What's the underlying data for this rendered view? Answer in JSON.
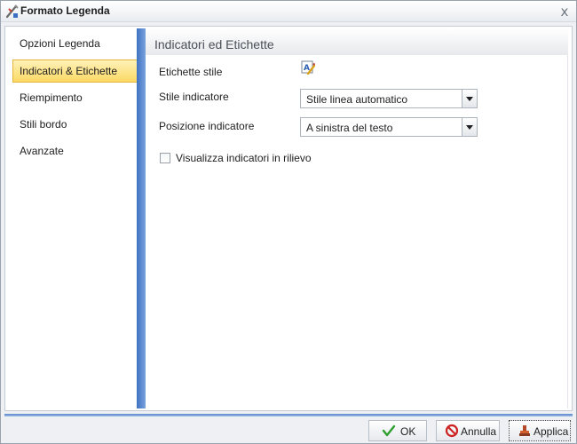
{
  "window": {
    "title": "Formato Legenda",
    "close_symbol": "x"
  },
  "sidebar": {
    "items": [
      {
        "label": "Opzioni Legenda",
        "selected": false
      },
      {
        "label": "Indicatori & Etichette",
        "selected": true
      },
      {
        "label": "Riempimento",
        "selected": false
      },
      {
        "label": "Stili bordo",
        "selected": false
      },
      {
        "label": "Avanzate",
        "selected": false
      }
    ]
  },
  "content": {
    "title": "Indicatori ed Etichette",
    "label_style": {
      "label": "Etichette stile",
      "icon": "text-style-icon"
    },
    "indicator_style": {
      "label": "Stile indicatore",
      "value": "Stile linea automatico"
    },
    "indicator_position": {
      "label": "Posizione indicatore",
      "value": "A sinistra del testo"
    },
    "relief_checkbox": {
      "label": "Visualizza indicatori in rilievo",
      "checked": false
    }
  },
  "footer": {
    "ok_label": "OK",
    "cancel_label": "Annulla",
    "apply_label": "Applica"
  },
  "colors": {
    "selected_bg": "#fbd964",
    "accent_blue": "#3f72c3",
    "ok_green": "#2e9e2e",
    "cancel_red": "#cc2222"
  }
}
